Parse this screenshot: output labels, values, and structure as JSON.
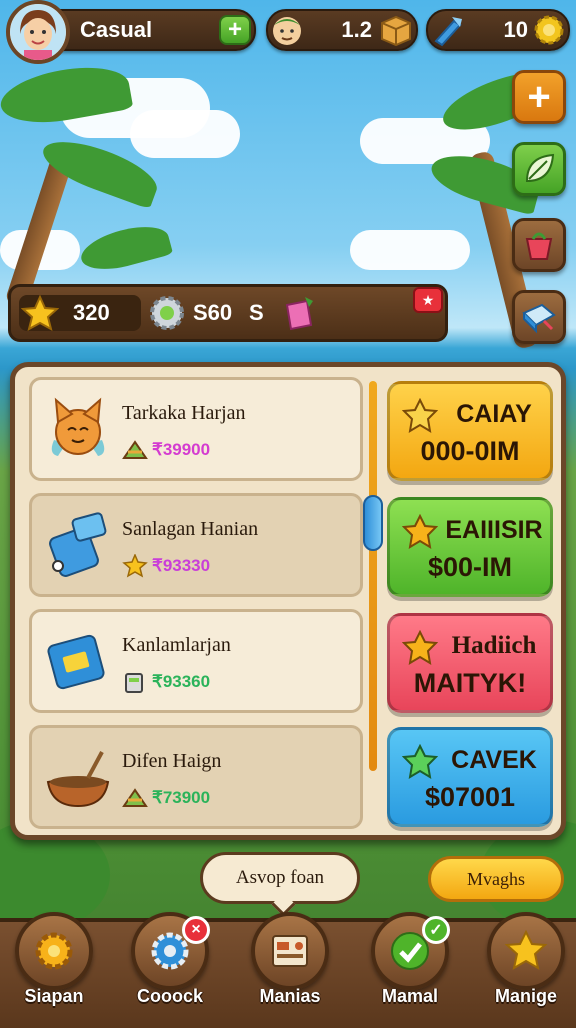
{
  "top_bar": {
    "player_mode": "Casual",
    "resource_1_value": "1.2",
    "resource_2_value": "10"
  },
  "resources": {
    "stars": "320",
    "gears": "S60",
    "extra": "S"
  },
  "shop_items": [
    {
      "name": "Tarkaka Harjan",
      "price": "₹39900",
      "price_color": "#d43cd0"
    },
    {
      "name": "Sanlagan Hanian",
      "price": "₹93330",
      "price_color": "#c93ed8"
    },
    {
      "name": "Kanlamlarjan",
      "price": "₹93360",
      "price_color": "#2bb35a"
    },
    {
      "name": "Difen Haign",
      "price": "₹73900",
      "price_color": "#2bb35a"
    }
  ],
  "offers": [
    {
      "title": "CAIAY",
      "value": "000-0IM",
      "color": "#f7b21a"
    },
    {
      "title": "EAIIISIR",
      "value": "$00-IM",
      "color": "#5bc12f"
    },
    {
      "title": "Hadiich",
      "value": "MAITYK!",
      "color": "#f2546a"
    },
    {
      "title": "CAVEK",
      "value": "$07001",
      "color": "#27a9e8"
    }
  ],
  "tooltip": "Asvop foan",
  "secondary_button": "Mvaghs",
  "nav": [
    {
      "label": "Siapan",
      "icon": "gear-icon"
    },
    {
      "label": "Cooock",
      "icon": "settings-icon"
    },
    {
      "label": "Manias",
      "icon": "map-icon"
    },
    {
      "label": "Mamal",
      "icon": "check-icon"
    },
    {
      "label": "Manige",
      "icon": "star-icon"
    }
  ]
}
